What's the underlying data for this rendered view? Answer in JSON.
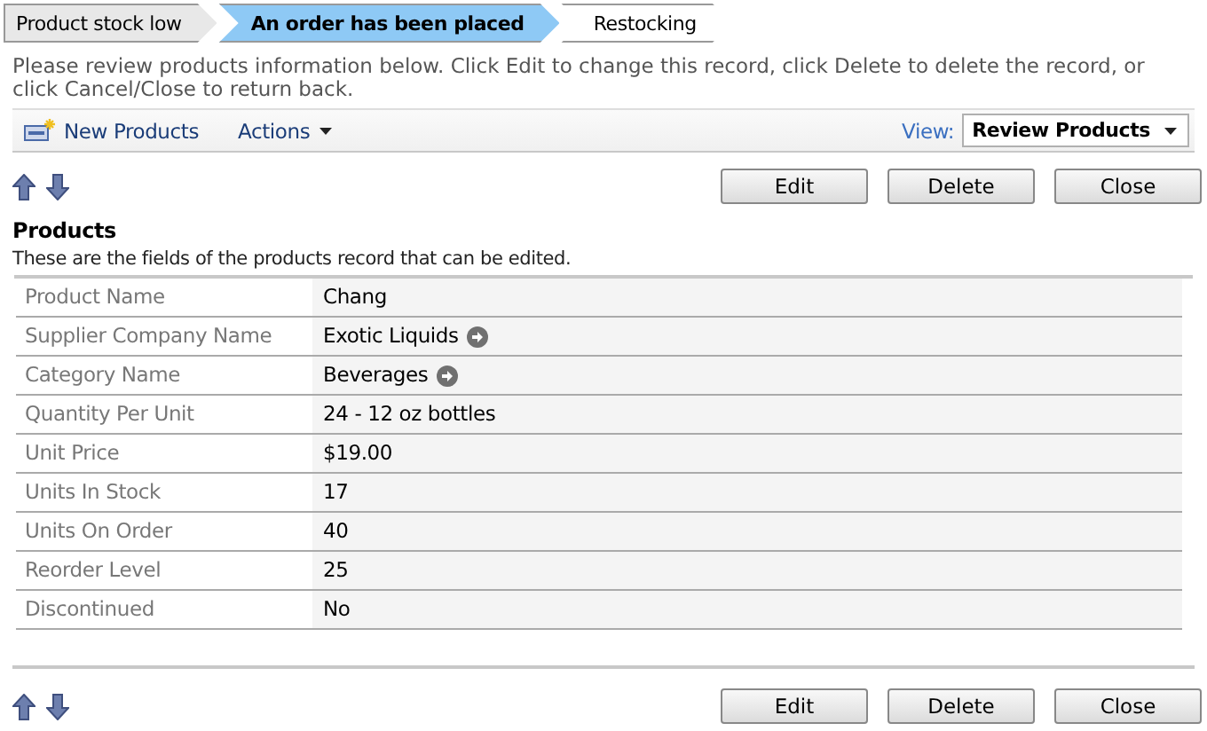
{
  "breadcrumb": [
    {
      "label": "Product stock low",
      "selected": false,
      "done": true
    },
    {
      "label": "An order has been placed",
      "selected": true,
      "done": false
    },
    {
      "label": "Restocking",
      "selected": false,
      "done": false
    }
  ],
  "instructions": "Please review products information below. Click Edit to change this record, click Delete to delete the record, or click Cancel/Close to return back.",
  "toolbar": {
    "new_label": "New Products",
    "actions_label": "Actions",
    "view_label": "View:",
    "view_value": "Review Products"
  },
  "buttons": [
    "Edit",
    "Delete",
    "Close"
  ],
  "section": {
    "title": "Products",
    "subtitle": "These are the fields of the products record that can be edited."
  },
  "fields": [
    {
      "label": "Product Name",
      "value": "Chang",
      "link": false
    },
    {
      "label": "Supplier Company Name",
      "value": "Exotic Liquids",
      "link": true
    },
    {
      "label": "Category Name",
      "value": "Beverages",
      "link": true
    },
    {
      "label": "Quantity Per Unit",
      "value": "24 - 12 oz bottles",
      "link": false
    },
    {
      "label": "Unit Price",
      "value": "$19.00",
      "link": false
    },
    {
      "label": "Units In Stock",
      "value": "17",
      "link": false
    },
    {
      "label": "Units On Order",
      "value": "40",
      "link": false
    },
    {
      "label": "Reorder Level",
      "value": "25",
      "link": false
    },
    {
      "label": "Discontinued",
      "value": "No",
      "link": false
    }
  ],
  "bottom_buttons": [
    "Edit",
    "Delete",
    "Close"
  ]
}
